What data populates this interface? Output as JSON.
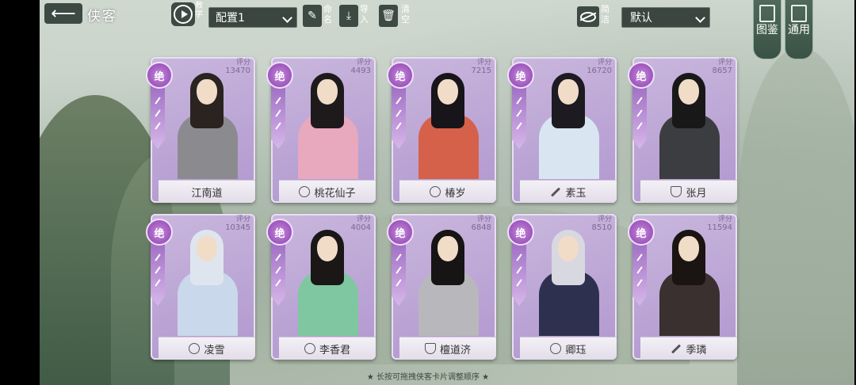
{
  "header": {
    "back_icon": "back-arrow-icon",
    "title": "侠客",
    "tutorial_label": "教学",
    "config_select": "配置1",
    "rename_label": "命名",
    "import_label": "导入",
    "clear_label": "清空",
    "simplify_label": "简洁",
    "sort_select": "默认"
  },
  "side_tabs": {
    "codex_label": "图鉴",
    "general_label": "通用"
  },
  "score_label": "评分",
  "cards": [
    {
      "rarity": "绝",
      "score": "13470",
      "name": "江南道",
      "type_icon": "",
      "hair": "#2a2320",
      "robe": "#8b8b8f"
    },
    {
      "rarity": "绝",
      "score": "4493",
      "name": "桃花仙子",
      "type_icon": "lotus-icon",
      "hair": "#1e1a1c",
      "robe": "#e8a8be"
    },
    {
      "rarity": "绝",
      "score": "7215",
      "name": "椿岁",
      "type_icon": "flame-swirl-icon",
      "hair": "#17141a",
      "robe": "#d6614a"
    },
    {
      "rarity": "绝",
      "score": "16720",
      "name": "素玉",
      "type_icon": "sword-icon",
      "hair": "#1d1a22",
      "robe": "#d9e6f2"
    },
    {
      "rarity": "绝",
      "score": "8657",
      "name": "张月",
      "type_icon": "shield-icon",
      "hair": "#181818",
      "robe": "#3b3d40"
    },
    {
      "rarity": "绝",
      "score": "10345",
      "name": "凌雪",
      "type_icon": "flame-swirl-icon",
      "hair": "#dfe5ee",
      "robe": "#c9d8ea"
    },
    {
      "rarity": "绝",
      "score": "4004",
      "name": "李香君",
      "type_icon": "lotus-icon",
      "hair": "#1a1716",
      "robe": "#7fc7a0"
    },
    {
      "rarity": "绝",
      "score": "6848",
      "name": "檀道济",
      "type_icon": "shield-icon",
      "hair": "#161414",
      "robe": "#b8b8bc"
    },
    {
      "rarity": "绝",
      "score": "8510",
      "name": "卿珏",
      "type_icon": "flame-swirl-icon",
      "hair": "#d8d8e0",
      "robe": "#2e3050"
    },
    {
      "rarity": "绝",
      "score": "11594",
      "name": "季璘",
      "type_icon": "sword-icon",
      "hair": "#1a1412",
      "robe": "#3a3030"
    }
  ],
  "footer_hint": "★ 长按可拖拽侠客卡片调整顺序 ★"
}
